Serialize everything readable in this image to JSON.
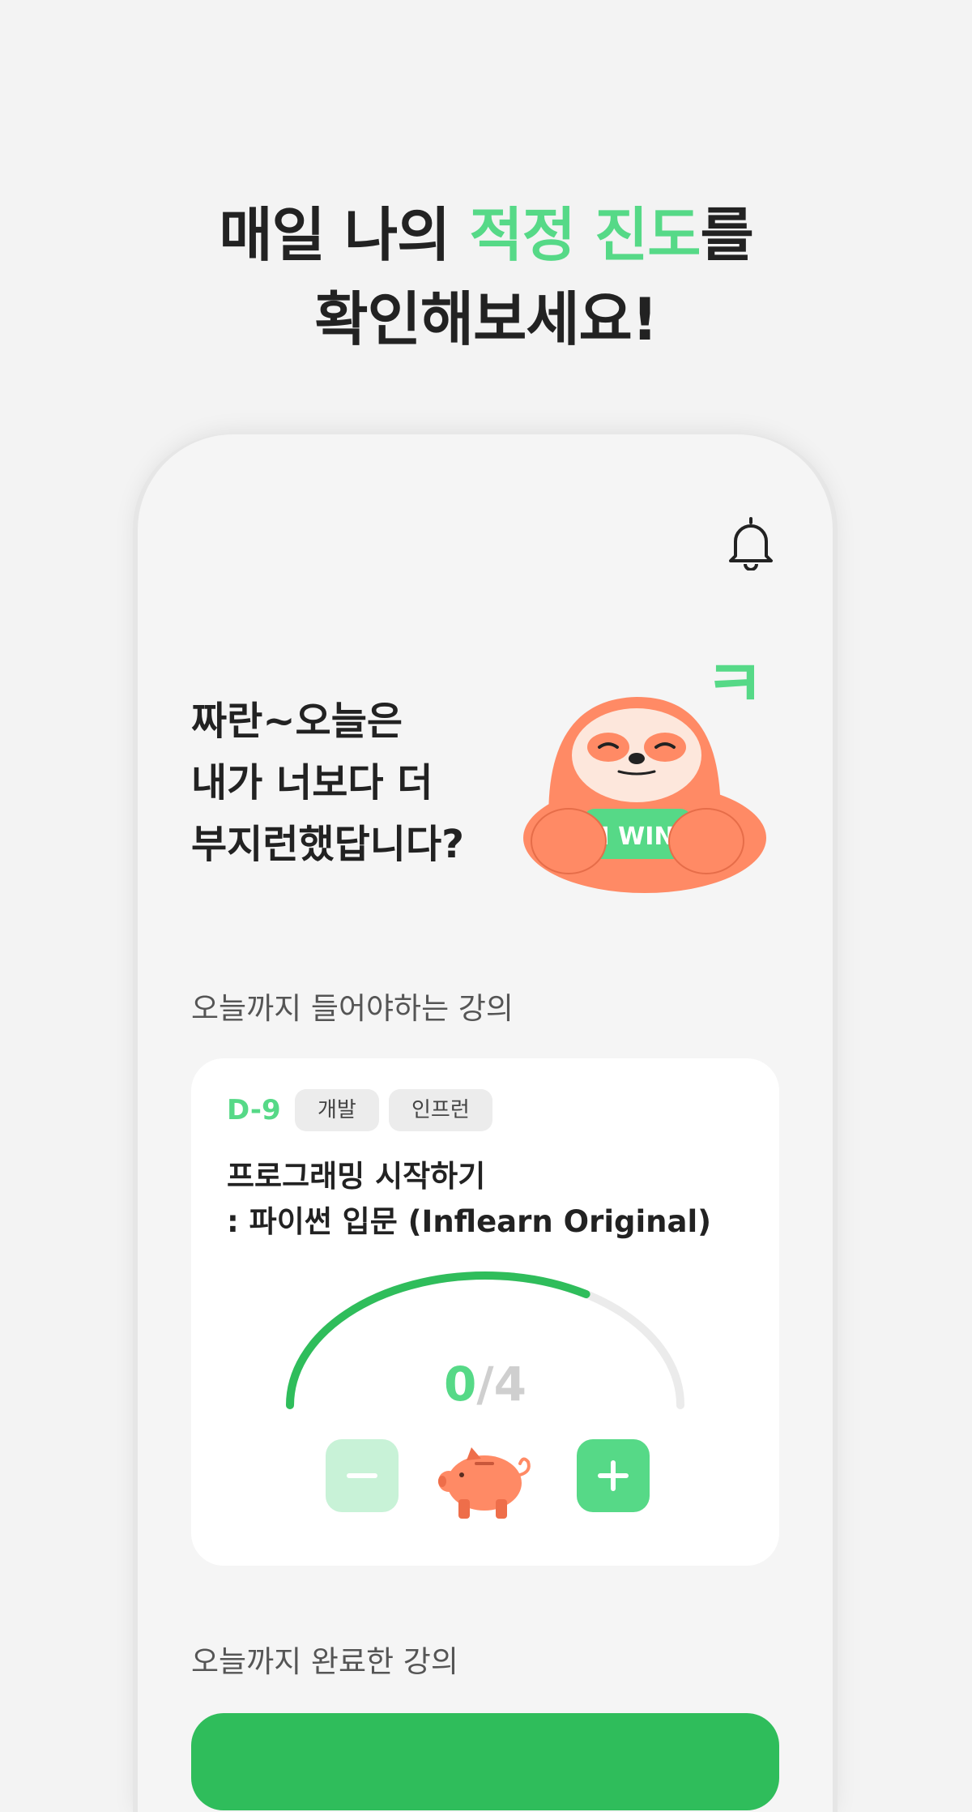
{
  "headline": {
    "line1_prefix": "매일 나의 ",
    "line1_accent": "적정 진도",
    "line1_suffix": "를",
    "line2": "확인해보세요!"
  },
  "greeting": {
    "line1": "짜란~오늘은",
    "line2": "내가 너보다 더",
    "line3": "부지런했답니다?"
  },
  "mascot": {
    "badge_text": "I WIN",
    "bubble_glyph": "ㅋ"
  },
  "sections": {
    "today_required": "오늘까지 들어야하는 강의",
    "today_completed": "오늘까지 완료한 강의"
  },
  "course": {
    "dday": "D-9",
    "tags": [
      "개발",
      "인프런"
    ],
    "title_line1": "프로그래밍 시작하기",
    "title_line2": ": 파이썬 입문 (Inflearn Original)",
    "progress_current": "0",
    "progress_separator": "/",
    "progress_total": "4",
    "gauge_fill_fraction": 0.7
  },
  "colors": {
    "accent": "#56d987",
    "gauge_fill": "#2fbd5b",
    "gauge_track": "#ebebeb",
    "mascot_orange": "#ff8a65"
  },
  "icons": {
    "bell": "bell-icon",
    "minus": "minus-icon",
    "plus": "plus-icon",
    "piggy": "piggy-bank-icon"
  }
}
